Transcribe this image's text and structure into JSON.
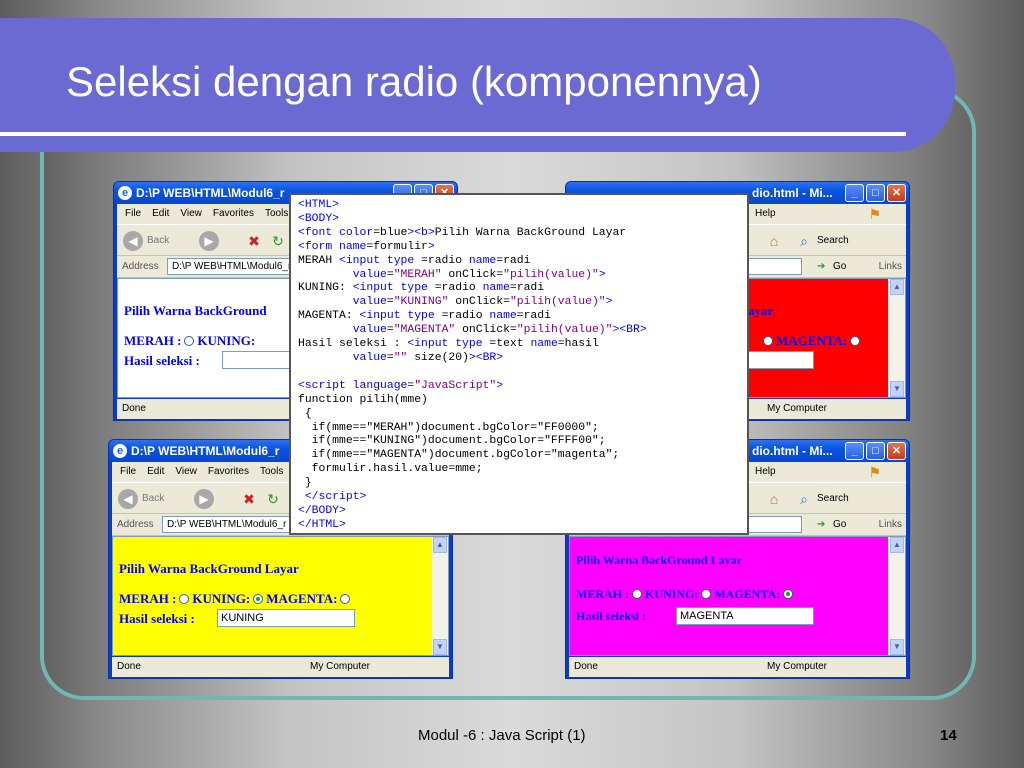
{
  "slide": {
    "title": "Seleksi dengan radio (komponennya)",
    "footer": "Modul -6 : Java Script (1)",
    "page_number": "14"
  },
  "browser": {
    "title_left": "D:\\P WEB\\HTML\\Modul6_r",
    "title_right": "dio.html - Mi...",
    "menu": [
      "File",
      "Edit",
      "View",
      "Favorites",
      "Tools",
      "Help"
    ],
    "back_label": "Back",
    "search_label": "Search",
    "address_label": "Address",
    "address_left": "D:\\P WEB\\HTML\\Modul6_r",
    "address_right": "radio.ht",
    "go_label": "Go",
    "links_label": "Links",
    "status_done": "Done",
    "status_computer": "My Computer"
  },
  "page": {
    "heading": "Pilih Warna BackGround Layar",
    "heading_clipped": "Pilih Warna BackGround",
    "merah": "MERAH :",
    "kuning": "KUNING:",
    "magenta": "MAGENTA:",
    "hasil_label": "Hasil seleksi :"
  },
  "windows": [
    {
      "position": "top-left",
      "bg_color": "#ffffff",
      "selected": null,
      "value": ""
    },
    {
      "position": "top-right",
      "bg_color": "#ff0000",
      "selected": null,
      "value": ""
    },
    {
      "position": "bottom-left",
      "bg_color": "#ffff00",
      "selected": "KUNING",
      "value": "KUNING"
    },
    {
      "position": "bottom-right",
      "bg_color": "#ff00ff",
      "selected": "MAGENTA",
      "value": "MAGENTA"
    }
  ],
  "colors": {
    "title_band": "#6a6ad2",
    "teal_frame": "#6fb7b2",
    "xp_title": "#0a54e0"
  }
}
